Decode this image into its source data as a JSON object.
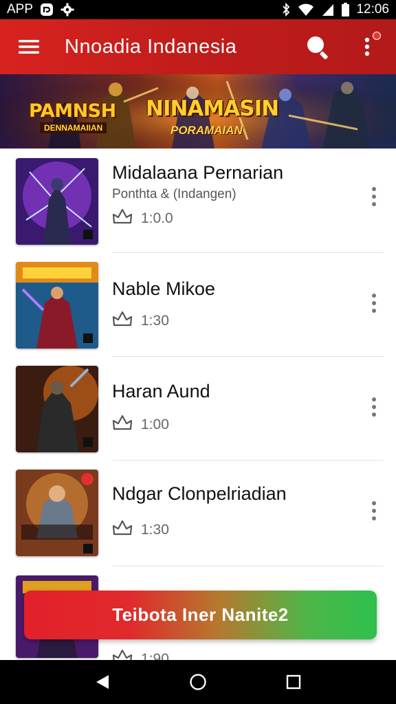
{
  "status_bar": {
    "left_label": "APP",
    "time": "12:06",
    "icons": [
      "notification-icon",
      "settings-gear-icon",
      "bluetooth-icon",
      "wifi-icon",
      "signal-icon",
      "battery-icon"
    ]
  },
  "app_bar": {
    "title": "Nnoadia Indanesia",
    "icons": [
      "menu-icon",
      "search-icon",
      "more-vert-icon"
    ]
  },
  "banner": {
    "left_title": "PAMNSH",
    "left_subtitle": "DENNAMAIIAN",
    "right_title": "NINAMASIN",
    "right_subtitle": "PORAMAIAN"
  },
  "items": [
    {
      "title": "Midalaana Pernarian",
      "subtitle": "Ponthta & (Indangen)",
      "meta": "1:0.0"
    },
    {
      "title": "Nable Mikoe",
      "subtitle": "",
      "meta": "1:30"
    },
    {
      "title": "Haran Aund",
      "subtitle": "",
      "meta": "1:00"
    },
    {
      "title": "Ndgar Clonpelriadian",
      "subtitle": "",
      "meta": "1:30"
    },
    {
      "title": "",
      "subtitle": "",
      "meta": "1:90"
    }
  ],
  "cta": {
    "label": "Teibota Iner Nanite2"
  },
  "nav": {
    "icons": [
      "back-icon",
      "home-icon",
      "recents-icon"
    ]
  },
  "colors": {
    "app_bar": "#c21d1b",
    "cta_start": "#e3202a",
    "cta_end": "#2ec04e"
  }
}
